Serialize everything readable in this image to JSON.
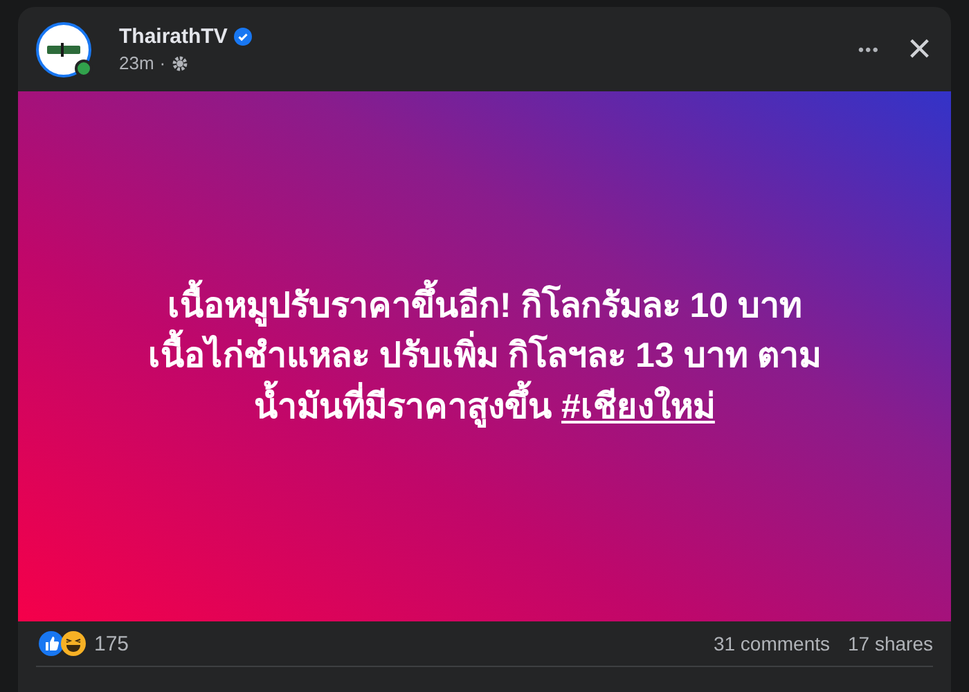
{
  "post": {
    "author": "ThairathTV",
    "verified": true,
    "online": true,
    "time": "23m",
    "separator": "·",
    "menu_icon": "•••",
    "close_icon": "×"
  },
  "image": {
    "lines": [
      "เนื้อหมูปรับราคาขึ้นอีก! กิโลกรัมละ 10 บาท",
      "เนื้อไก่ชำแหละ ปรับเพิ่ม กิโลฯละ 13 บาท ตาม",
      "น้ำมันที่มีราคาสูงขึ้น"
    ],
    "hashtag": "#เชียงใหม่"
  },
  "stats": {
    "reactions": "175",
    "comments": "31 comments",
    "shares": "17 shares"
  }
}
